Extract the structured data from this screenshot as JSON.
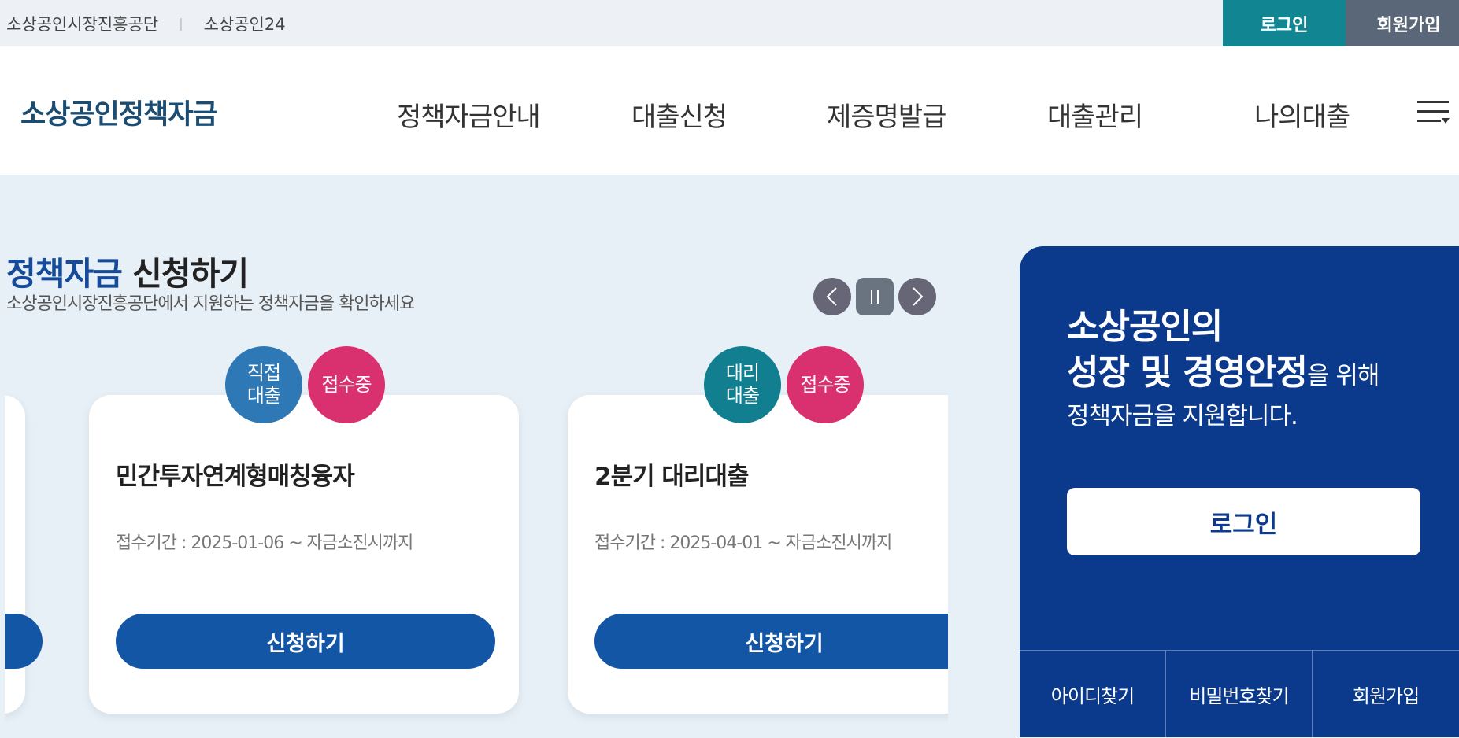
{
  "util": {
    "links": [
      "소상공인시장진흥공단",
      "소상공인24"
    ],
    "login": "로그인",
    "join": "회원가입"
  },
  "header": {
    "logo": "소상공인정책자금",
    "nav": [
      "정책자금안내",
      "대출신청",
      "제증명발급",
      "대출관리",
      "나의대출"
    ]
  },
  "section": {
    "title_accent": "정책자금",
    "title_rest": " 신청하기",
    "subtitle": "소상공인시장진흥공단에서 지원하는 정책자금을 확인하세요"
  },
  "cards": [
    {
      "type_badge": [
        "직접",
        "대출"
      ],
      "status_badge": "접수중",
      "title": "민간투자연계형매칭융자",
      "period": "접수기간 : 2025-01-06 ~ 자금소진시까지",
      "button": "신청하기"
    },
    {
      "type_badge": [
        "대리",
        "대출"
      ],
      "status_badge": "접수중",
      "title": "2분기 대리대출",
      "period": "접수기간 : 2025-04-01 ~ 자금소진시까지",
      "button": "신청하기"
    }
  ],
  "panel": {
    "line1": "소상공인의",
    "line2_bold": "성장 및 경영안정",
    "line2_small": "을 위해",
    "line3": "정책자금을 지원합니다.",
    "login_button": "로그인",
    "links": [
      "아이디찾기",
      "비밀번호찾기",
      "회원가입"
    ]
  },
  "colors": {
    "brand_blue": "#0b3a8c",
    "button_blue": "#1356a6",
    "teal": "#128592",
    "status_pink": "#d9306f"
  }
}
